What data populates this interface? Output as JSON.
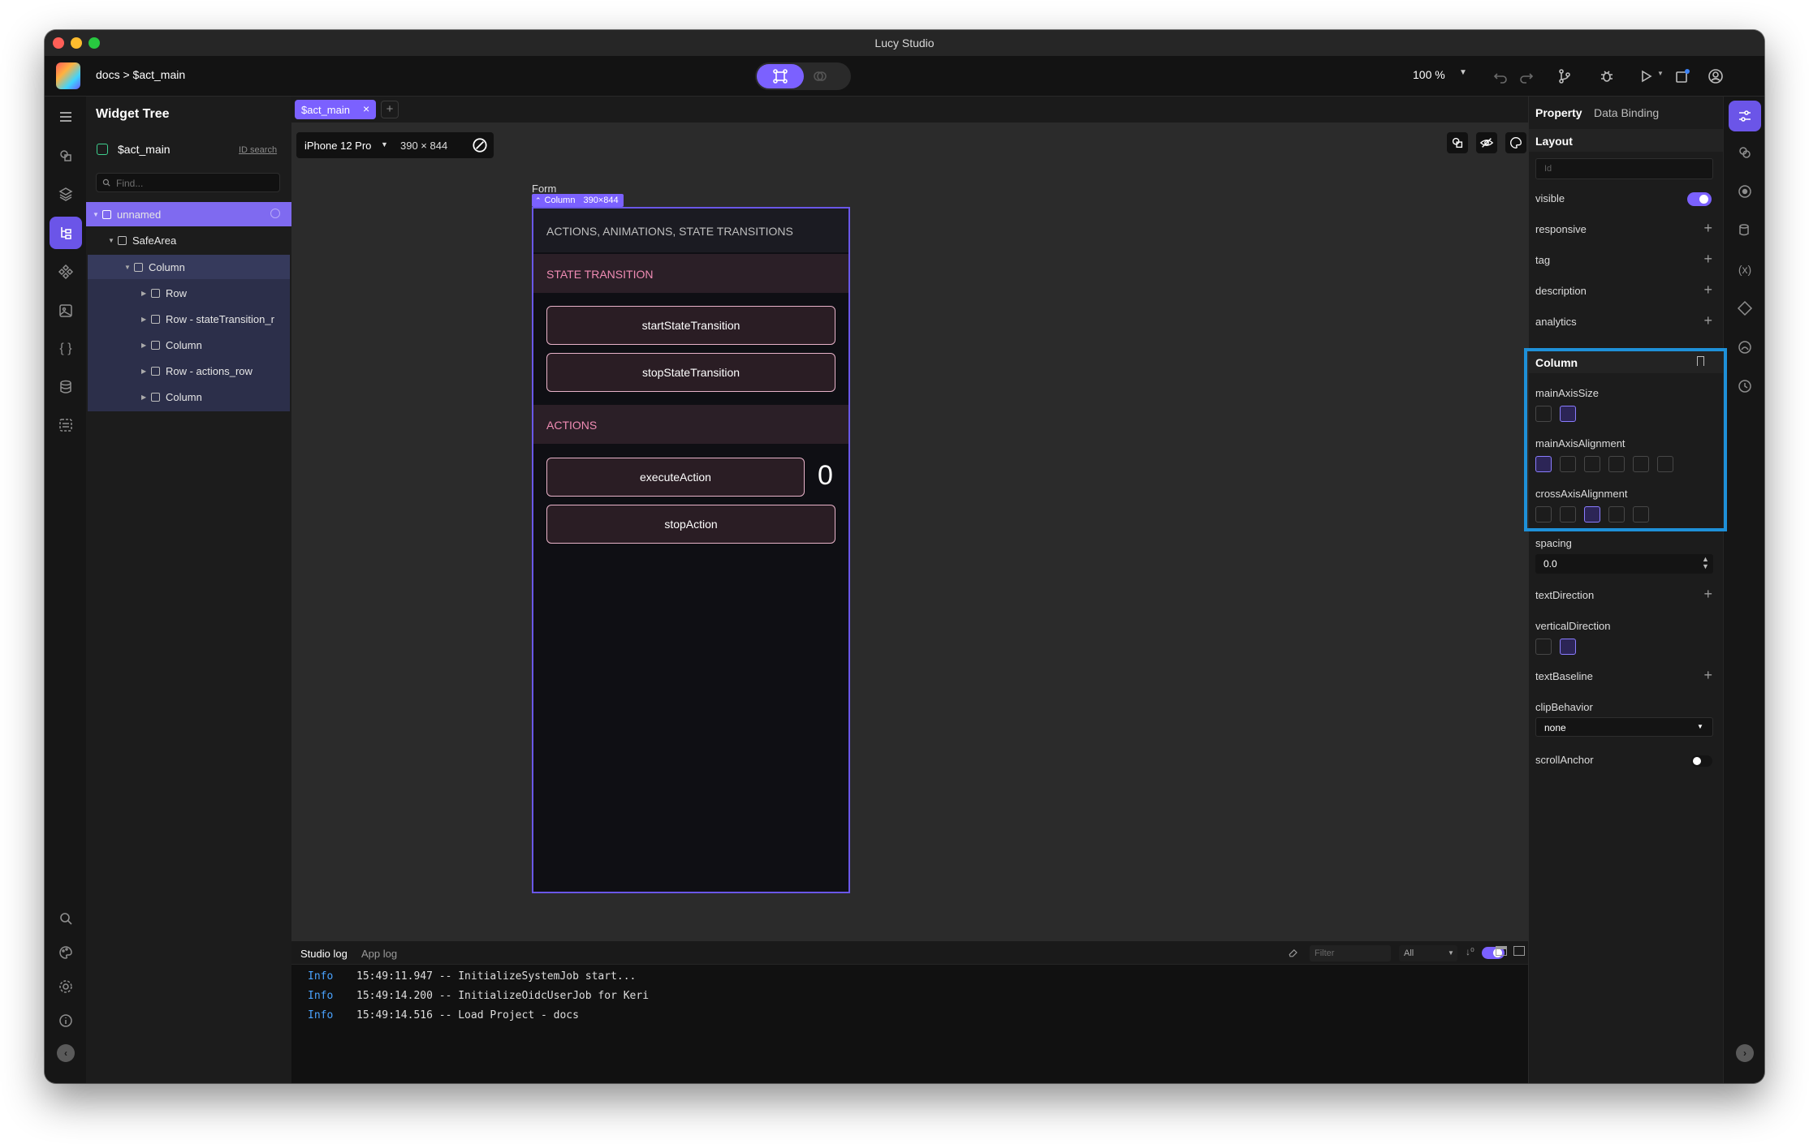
{
  "window": {
    "title": "Lucy Studio"
  },
  "header": {
    "breadcrumb": "docs > $act_main",
    "zoom": "100 %"
  },
  "tree": {
    "title": "Widget Tree",
    "root": "$act_main",
    "id_search": "ID search",
    "search_placeholder": "Find...",
    "nodes": [
      {
        "label": "unnamed"
      },
      {
        "label": "SafeArea"
      },
      {
        "label": "Column"
      },
      {
        "label": "Row"
      },
      {
        "label": "Row - stateTransition_r"
      },
      {
        "label": "Column"
      },
      {
        "label": "Row - actions_row"
      },
      {
        "label": "Column"
      }
    ]
  },
  "editor": {
    "tab": "$act_main",
    "device": "iPhone 12 Pro",
    "size": "390 × 844",
    "form_label": "Form",
    "selection_label": "Column",
    "selection_size": "390×844"
  },
  "phone": {
    "header": "ACTIONS, ANIMATIONS, STATE TRANSITIONS",
    "section_state": "STATE TRANSITION",
    "btn_start": "startStateTransition",
    "btn_stop": "stopStateTransition",
    "section_actions": "ACTIONS",
    "btn_execute": "executeAction",
    "counter": "0",
    "btn_stop_action": "stopAction"
  },
  "log": {
    "tab_studio": "Studio log",
    "tab_app": "App log",
    "filter_placeholder": "Filter",
    "level_select": "All",
    "lines": [
      {
        "level": "Info",
        "text": "15:49:11.947 -- InitializeSystemJob start..."
      },
      {
        "level": "Info",
        "text": "15:49:14.200 -- InitializeOidcUserJob for Keri"
      },
      {
        "level": "Info",
        "text": "15:49:14.516 -- Load Project - docs"
      }
    ]
  },
  "props": {
    "tab_property": "Property",
    "tab_binding": "Data Binding",
    "layout_title": "Layout",
    "id_placeholder": "Id",
    "visible": "visible",
    "responsive": "responsive",
    "tag": "tag",
    "description": "description",
    "analytics": "analytics",
    "column_title": "Column",
    "main_axis_size": "mainAxisSize",
    "main_axis_alignment": "mainAxisAlignment",
    "cross_axis_alignment": "crossAxisAlignment",
    "spacing": "spacing",
    "spacing_value": "0.0",
    "text_direction": "textDirection",
    "vertical_direction": "verticalDirection",
    "text_baseline": "textBaseline",
    "clip_behavior": "clipBehavior",
    "clip_value": "none",
    "scroll_anchor": "scrollAnchor"
  },
  "colors": {
    "accent": "#7b61ff",
    "highlight_box": "#1e90d8",
    "section_text": "#f08cb4"
  }
}
